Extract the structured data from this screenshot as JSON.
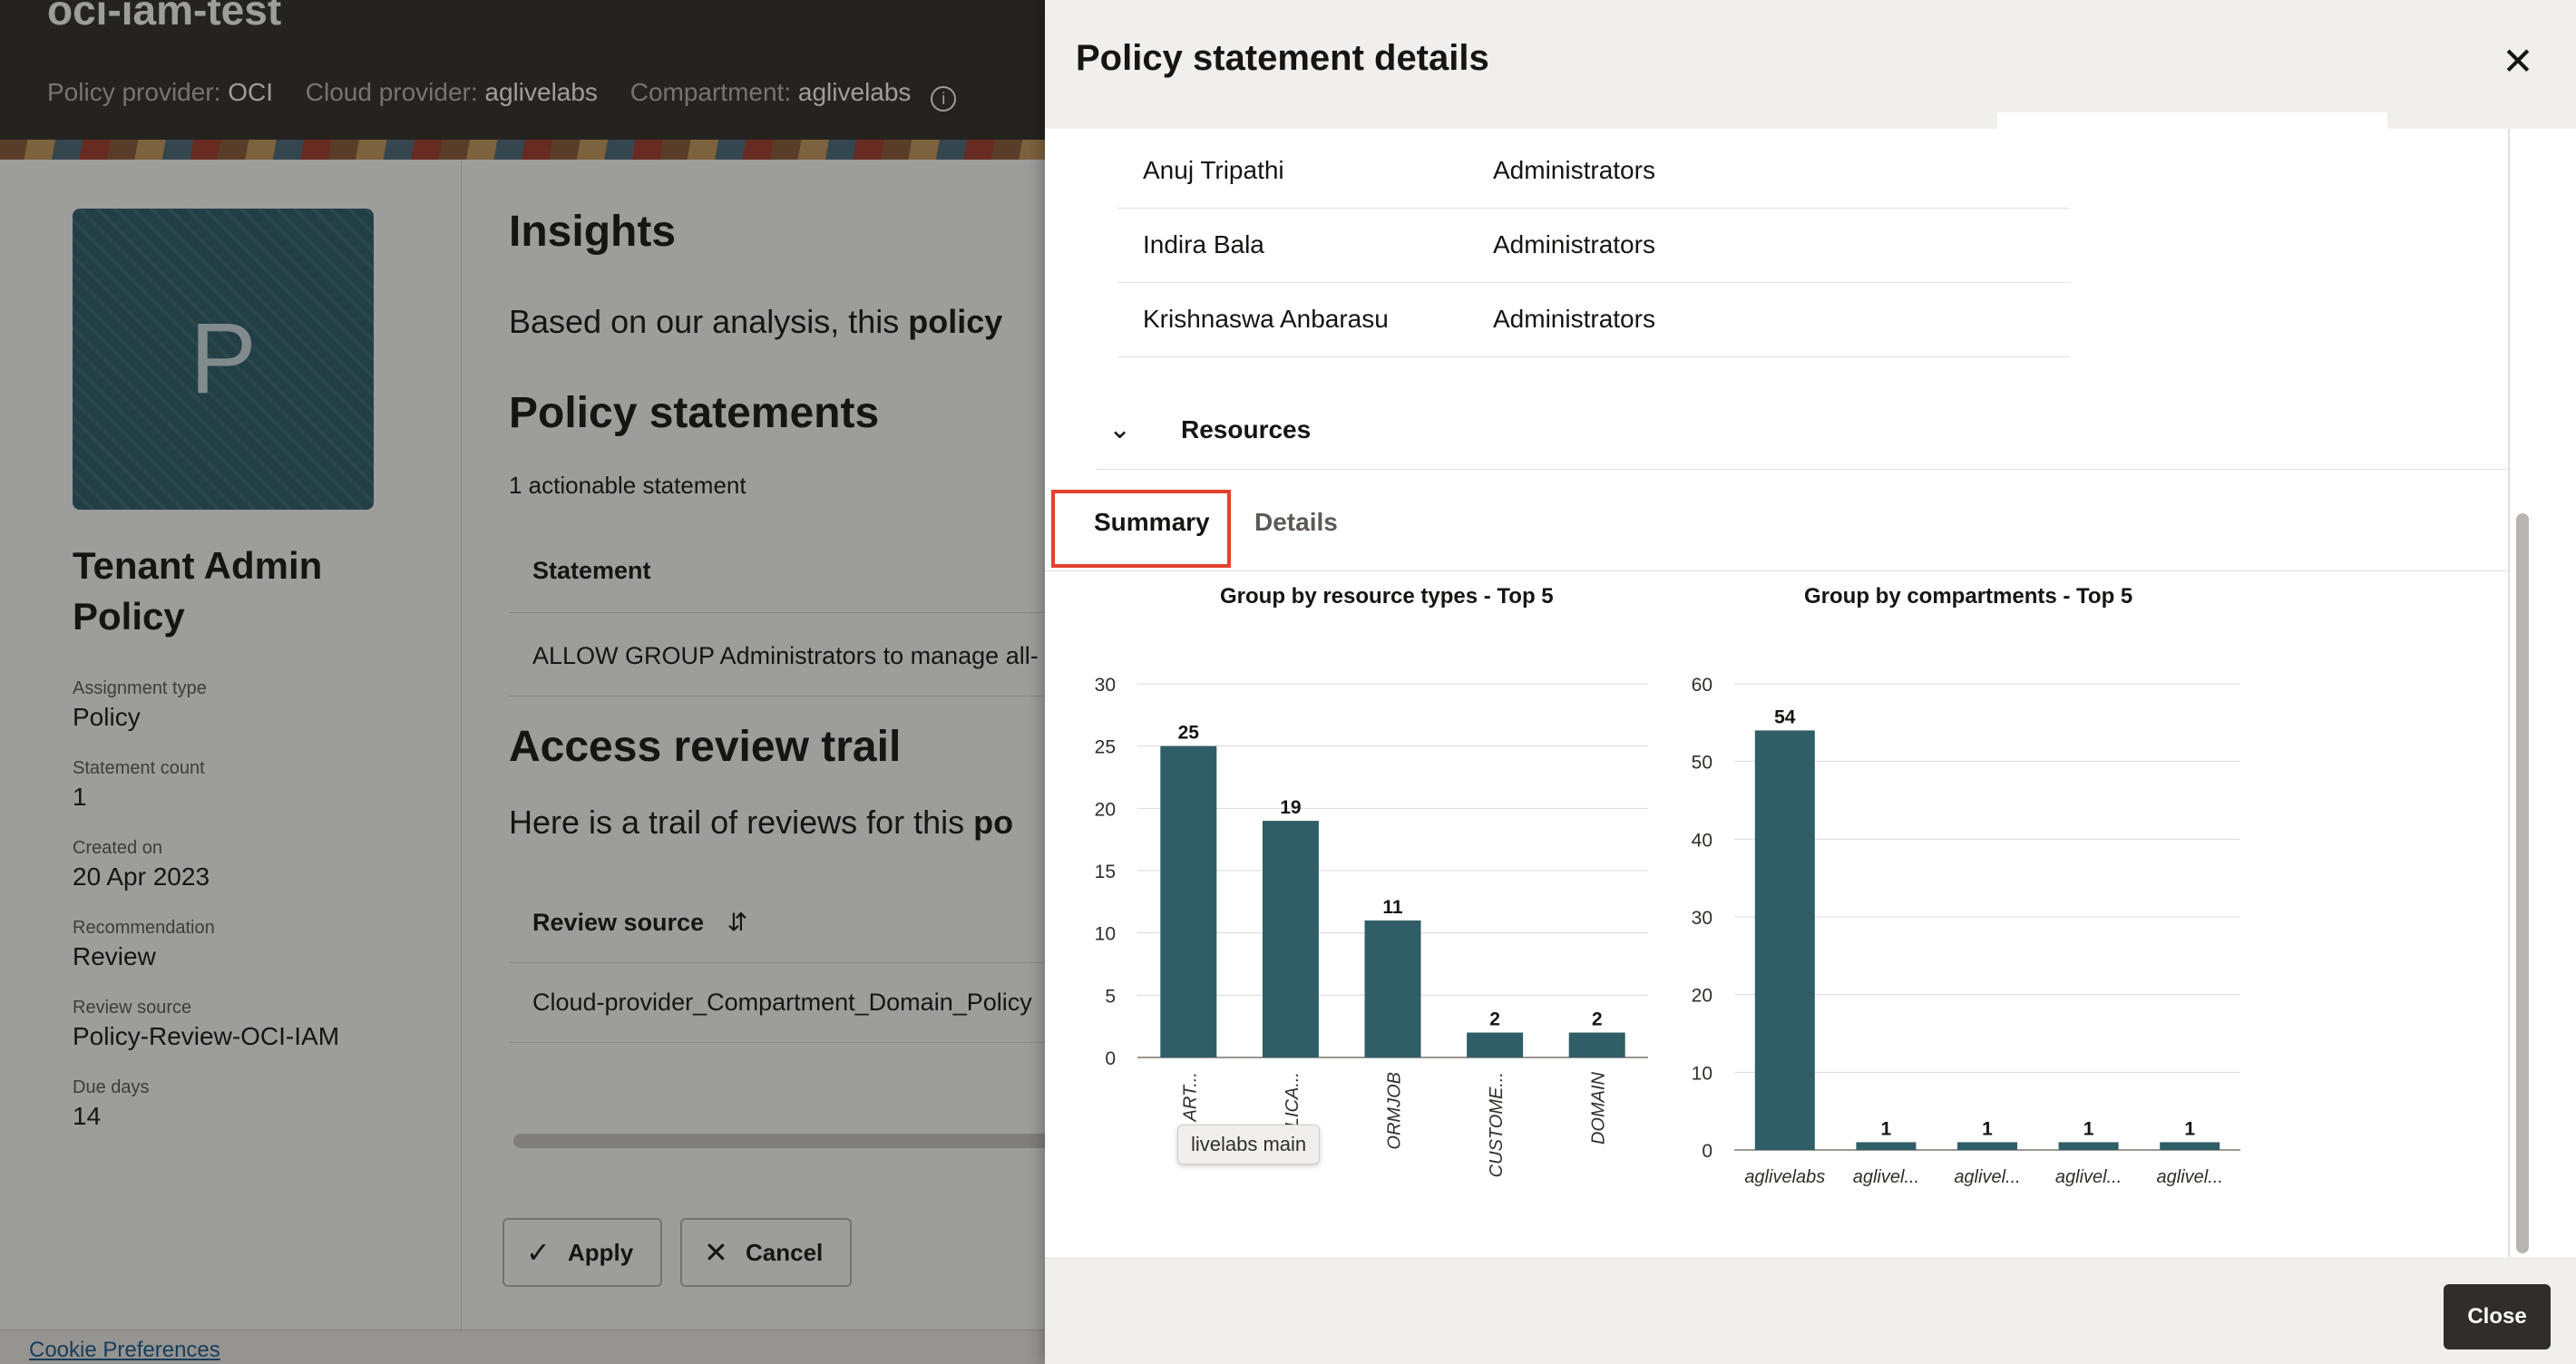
{
  "background": {
    "app_title": "oci-iam-test",
    "meta": [
      {
        "label": "Policy provider:",
        "value": "OCI"
      },
      {
        "label": "Cloud provider:",
        "value": "aglivelabs"
      },
      {
        "label": "Compartment:",
        "value": "aglivelabs"
      }
    ],
    "avatar_letter": "P",
    "policy_name": "Tenant Admin Policy",
    "properties": [
      {
        "label": "Assignment type",
        "value": "Policy"
      },
      {
        "label": "Statement count",
        "value": "1"
      },
      {
        "label": "Created on",
        "value": "20 Apr 2023"
      },
      {
        "label": "Recommendation",
        "value": "Review"
      },
      {
        "label": "Review source",
        "value": "Policy-Review-OCI-IAM"
      },
      {
        "label": "Due days",
        "value": "14"
      }
    ],
    "insights_heading": "Insights",
    "insights_text_prefix": "Based on our analysis, this ",
    "insights_text_bold": "policy",
    "statements_heading": "Policy statements",
    "statements_count": "1 actionable statement",
    "statement_col": "Statement",
    "statement_row": "ALLOW GROUP Administrators to manage all-",
    "trail_heading": "Access review trail",
    "trail_text_prefix": "Here is a trail of reviews for this ",
    "trail_text_bold": "po",
    "review_source_col": "Review source",
    "review_source_row": "Cloud-provider_Compartment_Domain_Policy",
    "apply_label": "Apply",
    "cancel_label": "Cancel",
    "cookie_label": "Cookie Preferences"
  },
  "drawer": {
    "title": "Policy statement details",
    "users": [
      {
        "name": "Anuj Tripathi",
        "group": "Administrators"
      },
      {
        "name": "Indira Bala",
        "group": "Administrators"
      },
      {
        "name": "Krishnaswa Anbarasu",
        "group": "Administrators"
      }
    ],
    "resources_label": "Resources",
    "tabs": [
      {
        "label": "Summary",
        "selected": true
      },
      {
        "label": "Details",
        "selected": false
      }
    ],
    "close_label": "Close",
    "tooltip": "livelabs main"
  },
  "chart_data": [
    {
      "type": "bar",
      "title": "Group by resource types - Top 5",
      "categories": [
        "COMPART...",
        "APPLICA...",
        "ORMJOB",
        "CUSTOME...",
        "DOMAIN"
      ],
      "tick_labels_visible": [
        "C…ART...",
        "…LICA...",
        "ORMJOB",
        "CUSTOME...",
        "DOMAIN"
      ],
      "values": [
        25,
        19,
        11,
        2,
        2
      ],
      "ylim": [
        0,
        30
      ],
      "yticks": [
        0,
        5,
        10,
        15,
        20,
        25,
        30
      ],
      "color": "#2f5e66"
    },
    {
      "type": "bar",
      "title": "Group by compartments - Top 5",
      "categories": [
        "aglivelabs",
        "aglivel...",
        "aglivel...",
        "aglivel...",
        "aglivel..."
      ],
      "values": [
        54,
        1,
        1,
        1,
        1
      ],
      "ylim": [
        0,
        60
      ],
      "yticks": [
        0,
        10,
        20,
        30,
        40,
        50,
        60
      ],
      "color": "#2f5e66"
    }
  ]
}
